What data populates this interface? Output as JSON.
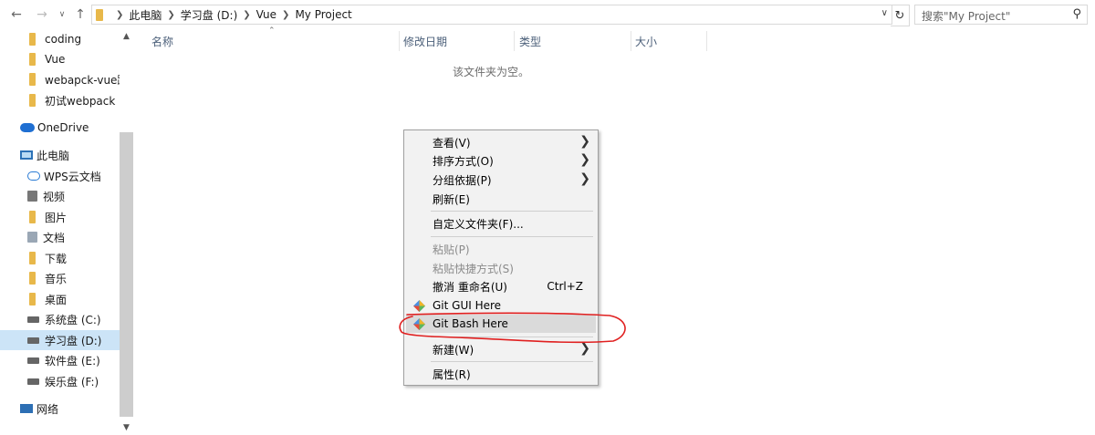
{
  "address": {
    "crumbs": [
      "此电脑",
      "学习盘 (D:)",
      "Vue",
      "My Project"
    ]
  },
  "search": {
    "placeholder": "搜索\"My Project\""
  },
  "sidebar": {
    "quick_access": [
      "coding",
      "Vue",
      "webapck-vue路",
      "初试webpack"
    ],
    "onedrive": "OneDrive",
    "this_pc": "此电脑",
    "pc_items": [
      "WPS云文档",
      "视频",
      "图片",
      "文档",
      "下载",
      "音乐",
      "桌面",
      "系统盘 (C:)",
      "学习盘 (D:)",
      "软件盘 (E:)",
      "娱乐盘 (F:)"
    ],
    "network": "网络"
  },
  "columns": [
    "名称",
    "修改日期",
    "类型",
    "大小"
  ],
  "empty_message": "该文件夹为空。",
  "context_menu": {
    "view": "查看(V)",
    "sort_by": "排序方式(O)",
    "group_by": "分组依据(P)",
    "refresh": "刷新(E)",
    "customize": "自定义文件夹(F)...",
    "paste": "粘贴(P)",
    "paste_shortcut": "粘贴快捷方式(S)",
    "undo_rename": "撤消 重命名(U)",
    "undo_shortcut": "Ctrl+Z",
    "git_gui": "Git GUI Here",
    "git_bash": "Git Bash Here",
    "new": "新建(W)",
    "properties": "属性(R)"
  },
  "colors": {
    "selection": "#cce4f7",
    "annotation": "#e02020",
    "menu_bg": "#f2f2f2"
  }
}
